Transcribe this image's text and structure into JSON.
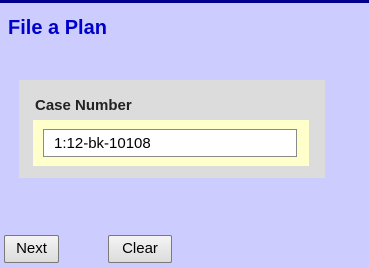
{
  "page": {
    "title": "File a Plan"
  },
  "case_panel": {
    "label": "Case Number",
    "input_value": "1:12-bk-10108"
  },
  "buttons": {
    "next_label": "Next",
    "clear_label": "Clear"
  },
  "colors": {
    "background": "#ccccff",
    "title": "#0000cc",
    "top_rule": "#00008b",
    "panel": "#dcdcdc",
    "input_highlight": "#ffffcc"
  }
}
